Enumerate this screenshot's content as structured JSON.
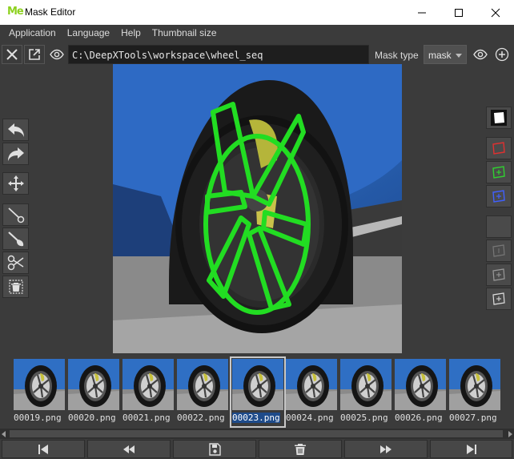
{
  "window": {
    "logo_text": "Me",
    "title": "Mask Editor"
  },
  "menu": {
    "items": [
      "Application",
      "Language",
      "Help",
      "Thumbnail size"
    ]
  },
  "toolbar": {
    "path": "C:\\DeepXTools\\workspace\\wheel_seq",
    "mask_type_label": "Mask type",
    "mask_type_value": "mask"
  },
  "icons": {
    "toolbar": [
      "close-icon",
      "open-external-icon",
      "eye-icon"
    ],
    "toolbar_right": [
      "eye-icon",
      "plus-icon"
    ],
    "left_tools": [
      "undo-icon",
      "redo-icon",
      "move-icon",
      "brush-icon",
      "fill-brush-icon",
      "cut-icon",
      "delete-mask-icon"
    ],
    "right_tools": [
      "mask-preview-icon",
      "red-polygon-icon",
      "green-polygon-icon",
      "blue-polygon-icon",
      "empty-slot-icon",
      "polygon-disabled-icon",
      "polygon-add-disabled-icon",
      "polygon-add-icon"
    ],
    "bottom": [
      "first-frame-icon",
      "rewind-icon",
      "save-icon",
      "trash-icon",
      "fast-forward-icon",
      "last-frame-icon"
    ]
  },
  "thumbnails": {
    "items": [
      {
        "label": "00019.png",
        "selected": false
      },
      {
        "label": "00020.png",
        "selected": false
      },
      {
        "label": "00021.png",
        "selected": false
      },
      {
        "label": "00022.png",
        "selected": false
      },
      {
        "label": "00023.png",
        "selected": true
      },
      {
        "label": "00024.png",
        "selected": false
      },
      {
        "label": "00025.png",
        "selected": false
      },
      {
        "label": "00026.png",
        "selected": false
      },
      {
        "label": "00027.png",
        "selected": false
      }
    ]
  },
  "colors": {
    "background": "#3b3b3b",
    "mask_green": "#22dd22",
    "car_blue": "#2f6fc4",
    "logo_green": "#8dd11f",
    "selection_blue": "#1e4b8a"
  }
}
